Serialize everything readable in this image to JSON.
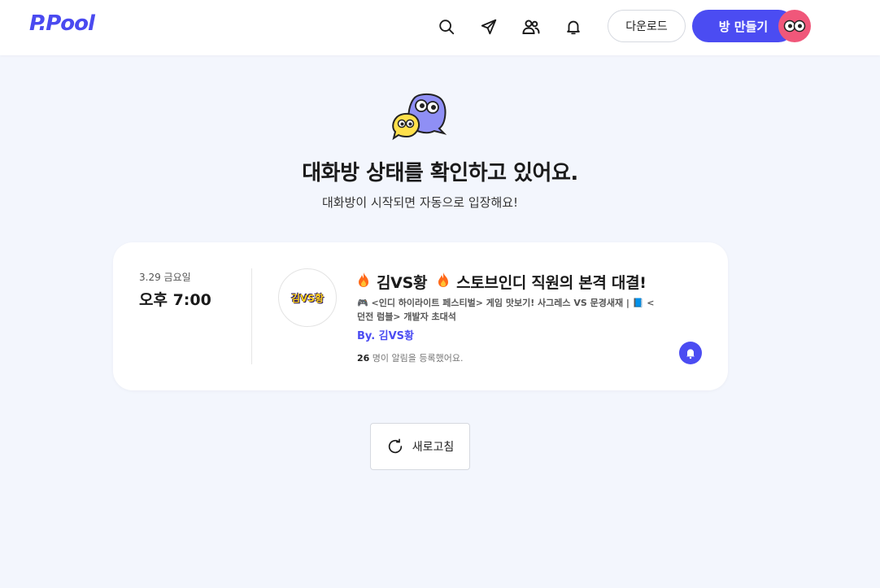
{
  "header": {
    "logo": "P.Pool",
    "icons": [
      "search-icon",
      "send-icon",
      "users-icon",
      "bell-icon"
    ],
    "download_label": "다운로드",
    "create_room_label": "방 만들기",
    "avatar_icon": "eyes-avatar-icon"
  },
  "hero": {
    "title": "대화방 상태를 확인하고 있어요.",
    "subtitle": "대화방이 시작되면 자동으로 입장해요!"
  },
  "event": {
    "date": "3.29 금요일",
    "time": "오후 7:00",
    "thumbnail_text": "김VS황",
    "title_part1": "김VS황",
    "title_part2": "스토브인디 직원의 본격 대결!",
    "description": "🎮 <인디 하이라이트 페스티벌> 게임 맛보기! 사그레스 VS 문경새재 | 📘 <던전 럼블> 개발자 초대석",
    "by": "By. 김VS황",
    "count_number": "26",
    "count_suffix": " 명이 알림을 등록했어요."
  },
  "refresh": {
    "label": "새로고침"
  },
  "colors": {
    "accent": "#4b4cf2",
    "background": "#f3f6fd",
    "avatar": "#f0577a"
  }
}
